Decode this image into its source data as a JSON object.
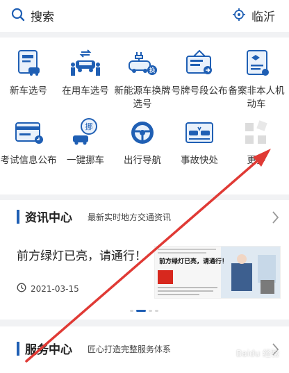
{
  "header": {
    "search_label": "搜索",
    "city": "临沂"
  },
  "grid": {
    "items": [
      {
        "name": "new-car-plate",
        "label": "新车选号"
      },
      {
        "name": "used-car-plate",
        "label": "在用车选号"
      },
      {
        "name": "ev-plate-swap",
        "label": "新能源车换牌选号"
      },
      {
        "name": "plate-segment",
        "label": "号牌号段公布"
      },
      {
        "name": "non-motor-record",
        "label": "备案非本人机动车"
      },
      {
        "name": "exam-info",
        "label": "考试信息公布"
      },
      {
        "name": "move-car",
        "label": "一键挪车"
      },
      {
        "name": "navigation",
        "label": "出行导航"
      },
      {
        "name": "accident",
        "label": "事故快处"
      },
      {
        "name": "more",
        "label": "更多"
      }
    ]
  },
  "news": {
    "title": "资讯中心",
    "subtitle": "最新实时地方交通资讯",
    "headline": "前方绿灯已亮，请通行！",
    "date": "2021-03-15",
    "thumb_banner": "前方绿灯已亮，请通行！",
    "slide_count": 4,
    "active_slide": 1
  },
  "service": {
    "title": "服务中心",
    "subtitle": "匠心打造完整服务体系"
  },
  "watermark": "Baidu 经验",
  "colors": {
    "brand": "#1f5fb4",
    "annotation": "#e03a35"
  }
}
